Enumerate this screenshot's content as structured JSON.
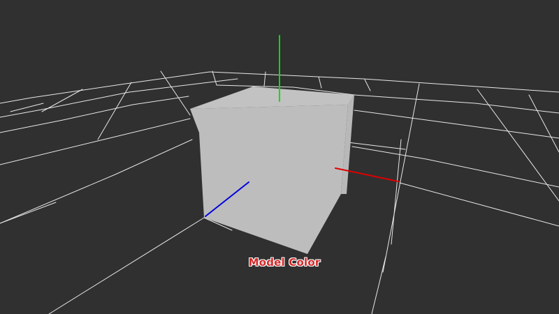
{
  "viewport": {
    "background_color": "#303030",
    "grid_color": "#e8e8e8",
    "caption": "Model Color",
    "caption_color": "#d42a2a"
  },
  "model": {
    "shape": "cube",
    "front_face_color": "#bdbdbd",
    "top_face_color": "#c2c2c2",
    "side_face_color": "#b8b8b8"
  },
  "axes": {
    "x_color": "#e00000",
    "y_color": "#00e000",
    "z_color": "#0000e0"
  }
}
